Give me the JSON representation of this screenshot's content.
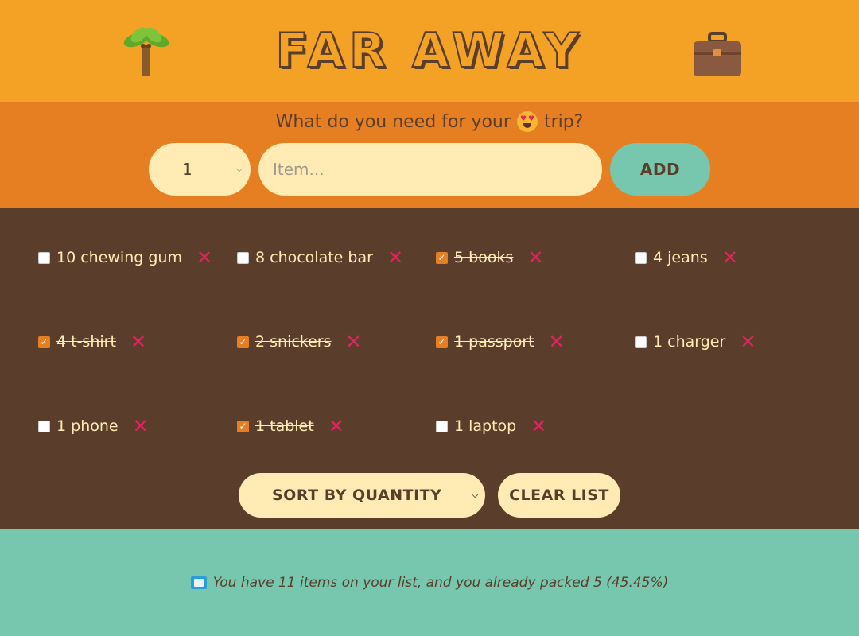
{
  "header": {
    "title": "FAR AWAY",
    "left_icon": "palm-tree-icon",
    "right_icon": "suitcase-icon"
  },
  "form": {
    "question_before": "What do you need for your",
    "question_emoji": "heart-eyes-emoji",
    "question_after": "trip?",
    "quantity_value": "1",
    "item_placeholder": "Item...",
    "add_label": "ADD"
  },
  "items": [
    {
      "label": "10 chewing gum",
      "packed": false
    },
    {
      "label": "8 chocolate bar",
      "packed": false
    },
    {
      "label": "5 books",
      "packed": true
    },
    {
      "label": "4 jeans",
      "packed": false
    },
    {
      "label": "4 t-shirt",
      "packed": true
    },
    {
      "label": "2 snickers",
      "packed": true
    },
    {
      "label": "1 passport",
      "packed": true
    },
    {
      "label": "1 charger",
      "packed": false
    },
    {
      "label": "1 phone",
      "packed": false
    },
    {
      "label": "1 tablet",
      "packed": true
    },
    {
      "label": "1 laptop",
      "packed": false
    }
  ],
  "actions": {
    "sort_value": "SORT BY QUANTITY",
    "clear_label": "CLEAR LIST"
  },
  "stats": {
    "text": "You have 11 items on your list, and you already packed 5 (45.45%)"
  },
  "colors": {
    "header_bg": "#f4a226",
    "form_bg": "#e67e22",
    "list_bg": "#5a3e2b",
    "stats_bg": "#76c7ad",
    "cream": "#ffebb3",
    "delete_red": "#e0245e"
  }
}
